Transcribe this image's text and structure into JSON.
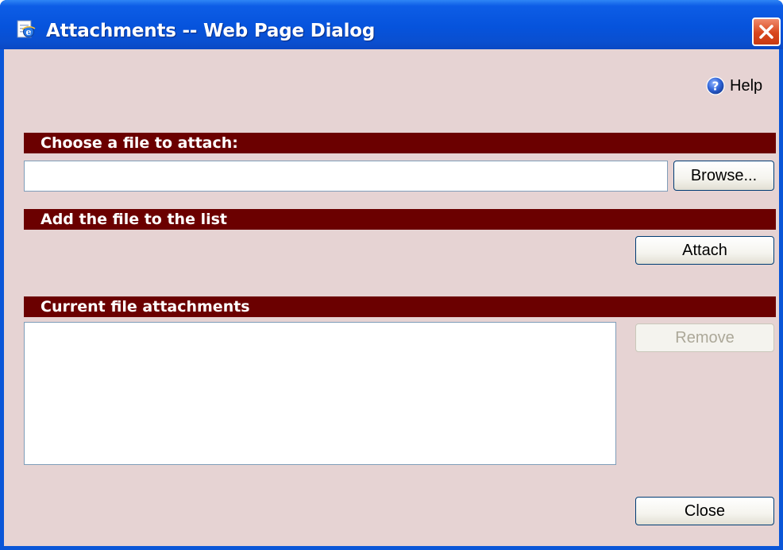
{
  "window": {
    "title": "Attachments -- Web Page Dialog"
  },
  "help": {
    "label": "Help"
  },
  "sections": {
    "choose_file": "Choose a file to attach:",
    "add_file": "Add the file to the list",
    "current_attachments": "Current file attachments"
  },
  "file_input": {
    "value": "",
    "placeholder": ""
  },
  "buttons": {
    "browse": "Browse...",
    "attach": "Attach",
    "remove": "Remove",
    "close": "Close"
  },
  "attachments": [],
  "colors": {
    "titlebar": "#0653dc",
    "client_background": "#e6d3d3",
    "section_bar": "#6b0000",
    "close_button": "#d8461c",
    "help_icon": "#2f63d6"
  },
  "icons": {
    "title": "ie-page-icon",
    "close": "close-icon",
    "help": "help-icon"
  }
}
